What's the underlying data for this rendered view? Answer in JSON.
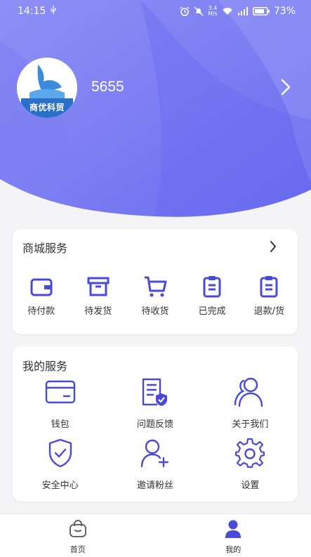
{
  "status": {
    "time": "14:15",
    "net_speed_value": "3.4",
    "net_speed_unit": "M/s",
    "battery": "73%"
  },
  "profile": {
    "avatar_text": "商优科贸",
    "username": "5655"
  },
  "shop_service": {
    "title": "商城服务",
    "orders": [
      {
        "label": "待付款",
        "icon": "wallet-icon"
      },
      {
        "label": "待发货",
        "icon": "archive-box-icon"
      },
      {
        "label": "待收货",
        "icon": "cart-icon"
      },
      {
        "label": "已完成",
        "icon": "clipboard-icon"
      },
      {
        "label": "退款/货",
        "icon": "clipboard-icon"
      }
    ]
  },
  "my_service": {
    "title": "我的服务",
    "items": [
      {
        "label": "钱包",
        "icon": "card-icon"
      },
      {
        "label": "问题反馈",
        "icon": "document-shield-icon"
      },
      {
        "label": "关于我们",
        "icon": "users-icon"
      },
      {
        "label": "安全中心",
        "icon": "shield-check-icon"
      },
      {
        "label": "邀请粉丝",
        "icon": "user-add-icon"
      },
      {
        "label": "设置",
        "icon": "gear-icon"
      }
    ]
  },
  "tabbar": {
    "tabs": [
      {
        "label": "首页",
        "icon": "shopping-bag-icon",
        "active": false
      },
      {
        "label": "我的",
        "icon": "person-icon",
        "active": true
      }
    ]
  },
  "colors": {
    "accent": "#4a4ad8",
    "hero_light": "#8d8ff5",
    "hero_dark": "#5c5eee",
    "background": "#f4f4f6"
  }
}
